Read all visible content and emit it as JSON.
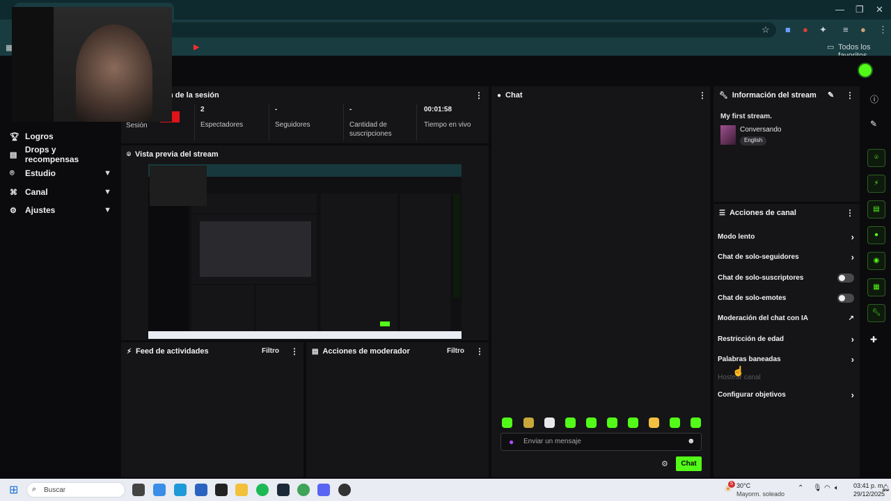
{
  "browser": {
    "bookmarks_folder": "Todos los favoritos"
  },
  "sidebar": {
    "items": [
      {
        "label": "Logros",
        "icon": "trophy-icon",
        "chevron": false
      },
      {
        "label": "Drops y recompensas",
        "icon": "gift-icon",
        "chevron": false
      },
      {
        "label": "Estudio",
        "icon": "studio-icon",
        "chevron": true
      },
      {
        "label": "Canal",
        "icon": "channel-icon",
        "chevron": true
      },
      {
        "label": "Ajustes",
        "icon": "gear-icon",
        "chevron": true
      }
    ]
  },
  "session": {
    "title_partial": "n de la sesión",
    "badge_partial": "o",
    "stats": [
      {
        "value": "",
        "label": "Sesión"
      },
      {
        "value": "2",
        "label": "Espectadores"
      },
      {
        "value": "-",
        "label": "Seguidores"
      },
      {
        "value": "-",
        "label": "Cantidad de suscripciones"
      },
      {
        "value": "00:01:58",
        "label": "Tiempo en vivo"
      }
    ]
  },
  "preview": {
    "title": "Vista previa del stream"
  },
  "feed": {
    "title": "Feed de actividades",
    "filter": "Filtro"
  },
  "moderator": {
    "title": "Acciones de moderador",
    "filter": "Filtro"
  },
  "chat": {
    "title": "Chat",
    "placeholder": "Enviar un mensaje",
    "send_label": "Chat",
    "accent": "#53fc18"
  },
  "stream_info": {
    "title": "Información del stream",
    "stream_title": "My first stream.",
    "category": "Conversando",
    "language": "English"
  },
  "channel_actions": {
    "title": "Acciones de canal",
    "rows": [
      {
        "label": "Modo lento",
        "control": "arrow"
      },
      {
        "label": "Chat de solo-seguidores",
        "control": "arrow"
      },
      {
        "label": "Chat de solo-suscriptores",
        "control": "toggle"
      },
      {
        "label": "Chat de solo-emotes",
        "control": "toggle"
      },
      {
        "label": "Moderación del chat con IA",
        "control": "external"
      },
      {
        "label": "Restricción de edad",
        "control": "arrow"
      },
      {
        "label": "Palabras baneadas",
        "control": "arrow"
      },
      {
        "label": "Hostear canal",
        "control": "disabled"
      },
      {
        "label": "Configurar objetivos",
        "control": "arrow"
      }
    ]
  },
  "taskbar": {
    "search_placeholder": "Buscar",
    "weather_temp": "30°C",
    "weather_desc": "Mayorm. soleado",
    "weather_badge": "5",
    "time": "03:41 p. m.",
    "date": "29/12/2025"
  }
}
